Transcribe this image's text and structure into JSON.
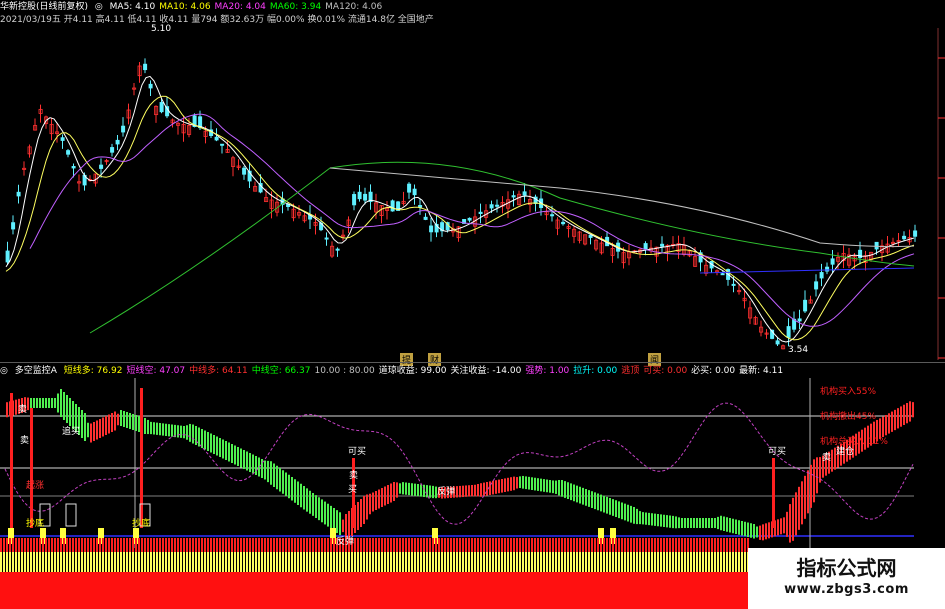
{
  "stock": {
    "name": "华新控股(日线前复权)",
    "ma_labels": [
      {
        "text": "MA5: 4.10",
        "color": "#ffffff"
      },
      {
        "text": "MA10: 4.06",
        "color": "#ffff00"
      },
      {
        "text": "MA20: 4.04",
        "color": "#ff40ff"
      },
      {
        "text": "MA60: 3.94",
        "color": "#00ff00"
      },
      {
        "text": "MA120: 4.06",
        "color": "#c0c0c0"
      }
    ],
    "info_line": "2021/03/19五 开4.11 高4.11 低4.11 收4.11 量794 额32.63万 幅0.00% 换0.01% 流通14.8亿 全国地产",
    "high_mark": "5.10",
    "low_mark": "3.54",
    "chips": [
      "提",
      "财"
    ],
    "chip_right": "闻"
  },
  "indicator": {
    "name": "多空监控A",
    "values": [
      {
        "text": "短线多: 76.92",
        "color": "#ffff00"
      },
      {
        "text": "短线空: 47.07",
        "color": "#ff40ff"
      },
      {
        "text": "中线多: 64.11",
        "color": "#ff3030"
      },
      {
        "text": "中线空: 66.37",
        "color": "#00ff00"
      },
      {
        "text": "10.00 : 80.00",
        "color": "#c0c0c0"
      },
      {
        "text": "道琼收益: 99.00",
        "color": "#ffffff"
      },
      {
        "text": "关注收益: -14.00",
        "color": "#ffffff"
      },
      {
        "text": "强势: 1.00",
        "color": "#ff40ff"
      },
      {
        "text": "拉升: 0.00",
        "color": "#00ffff"
      },
      {
        "text": "逃顶",
        "color": "#ff3030"
      },
      {
        "text": "可买: 0.00",
        "color": "#ff3030"
      },
      {
        "text": "必买: 0.00",
        "color": "#ffffff"
      },
      {
        "text": "最新: 4.11",
        "color": "#ffffff"
      }
    ],
    "legend": [
      {
        "text": "机构买入55%",
        "color": "#ff3030"
      },
      {
        "text": "机构撤出45%",
        "color": "#ff3030"
      },
      {
        "text": "机构总买入 11%",
        "color": "#ff3030"
      }
    ],
    "tags_red": [
      "卖",
      "追买",
      "卖",
      "卖",
      "卖"
    ],
    "tags_yellow": [
      "起涨",
      "抄底",
      "抄底"
    ],
    "tags_white": [
      "可买",
      "买",
      "反弹",
      "反弹",
      "可买",
      "建仓"
    ],
    "tag_short": "卖"
  },
  "watermark": {
    "title": "指标公式网",
    "url": "www.zbgs3.com"
  }
}
